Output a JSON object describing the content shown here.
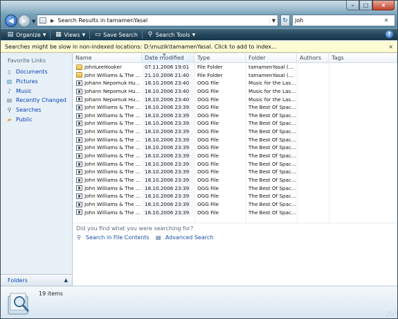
{
  "titlebar": {
    "address_path": "Search Results in tamamenYasal",
    "search_value": "joh",
    "caption_min": "–",
    "caption_max": "□",
    "caption_close": "×"
  },
  "toolbar": {
    "organize": "Organize",
    "views": "Views",
    "save_search": "Save Search",
    "search_tools": "Search Tools",
    "help": "?"
  },
  "infobar": {
    "message": "Searches might be slow in non-indexed locations: D:\\muzik\\tamamenYasal. Click to add to index...",
    "close": "×"
  },
  "navpane": {
    "title": "Favorite Links",
    "items": [
      {
        "label": "Documents",
        "icon": "documents-icon"
      },
      {
        "label": "Pictures",
        "icon": "pictures-icon"
      },
      {
        "label": "Music",
        "icon": "music-icon"
      },
      {
        "label": "Recently Changed",
        "icon": "recently-changed-icon"
      },
      {
        "label": "Searches",
        "icon": "searches-icon"
      },
      {
        "label": "Public",
        "icon": "public-icon"
      }
    ],
    "folders_label": "Folders"
  },
  "columns": [
    "Name",
    "Date modified",
    "Type",
    "Folder",
    "Authors",
    "Tags"
  ],
  "files": [
    {
      "name": "JohnLeeHooker",
      "date": "07.11.2006 19:01",
      "type": "File Folder",
      "folder": "tamamenYasal (D:...",
      "kind": "folder"
    },
    {
      "name": "John Williams & The B...",
      "date": "21.10.2006 21:40",
      "type": "File Folder",
      "folder": "tamamenYasal (D:...",
      "kind": "folder"
    },
    {
      "name": "Johann Nepomuk Hu...",
      "date": "18.10.2006 23:40",
      "type": "OGG File",
      "folder": "Music for the Last ...",
      "kind": "ogg"
    },
    {
      "name": "Johann Nepomuk Hu...",
      "date": "18.10.2006 23:40",
      "type": "OGG File",
      "folder": "Music for the Last ...",
      "kind": "ogg"
    },
    {
      "name": "Johann Nepomuk Hu...",
      "date": "18.10.2006 23:40",
      "type": "OGG File",
      "folder": "Music for the Last ...",
      "kind": "ogg"
    },
    {
      "name": "John Williams & The B...",
      "date": "18.10.2006 23:39",
      "type": "OGG File",
      "folder": "The Best Of Space...",
      "kind": "ogg"
    },
    {
      "name": "John Williams & The B...",
      "date": "18.10.2006 23:39",
      "type": "OGG File",
      "folder": "The Best Of Space...",
      "kind": "ogg"
    },
    {
      "name": "John Williams & The B...",
      "date": "18.10.2006 23:39",
      "type": "OGG File",
      "folder": "The Best Of Space...",
      "kind": "ogg"
    },
    {
      "name": "John Williams & The B...",
      "date": "18.10.2006 23:39",
      "type": "OGG File",
      "folder": "The Best Of Space...",
      "kind": "ogg"
    },
    {
      "name": "John Williams & The B...",
      "date": "18.10.2006 23:39",
      "type": "OGG File",
      "folder": "The Best Of Space...",
      "kind": "ogg"
    },
    {
      "name": "John Williams & The B...",
      "date": "18.10.2006 23:39",
      "type": "OGG File",
      "folder": "The Best Of Space...",
      "kind": "ogg"
    },
    {
      "name": "John Williams & The B...",
      "date": "18.10.2006 23:39",
      "type": "OGG File",
      "folder": "The Best Of Space...",
      "kind": "ogg"
    },
    {
      "name": "John Williams & The B...",
      "date": "18.10.2006 23:39",
      "type": "OGG File",
      "folder": "The Best Of Space...",
      "kind": "ogg"
    },
    {
      "name": "John Williams & The B...",
      "date": "18.10.2006 23:39",
      "type": "OGG File",
      "folder": "The Best Of Space...",
      "kind": "ogg"
    },
    {
      "name": "John Williams & The B...",
      "date": "18.10.2006 23:39",
      "type": "OGG File",
      "folder": "The Best Of Space...",
      "kind": "ogg"
    },
    {
      "name": "John Williams & The B...",
      "date": "18.10.2006 23:39",
      "type": "OGG File",
      "folder": "The Best Of Space...",
      "kind": "ogg"
    },
    {
      "name": "John Williams & The B...",
      "date": "18.10.2006 23:39",
      "type": "OGG File",
      "folder": "The Best Of Space...",
      "kind": "ogg"
    },
    {
      "name": "John Williams & The B...",
      "date": "18.10.2006 23:39",
      "type": "OGG File",
      "folder": "The Best Of Space...",
      "kind": "ogg"
    },
    {
      "name": "John Williams & The B...",
      "date": "18.10.2006 23:39",
      "type": "OGG File",
      "folder": "The Best Of Space...",
      "kind": "ogg"
    }
  ],
  "search_hint": {
    "question": "Did you find what you were searching for?",
    "search_in_file_contents": "Search in File Contents",
    "advanced_search": "Advanced Search"
  },
  "details": {
    "item_count": "19 items"
  }
}
